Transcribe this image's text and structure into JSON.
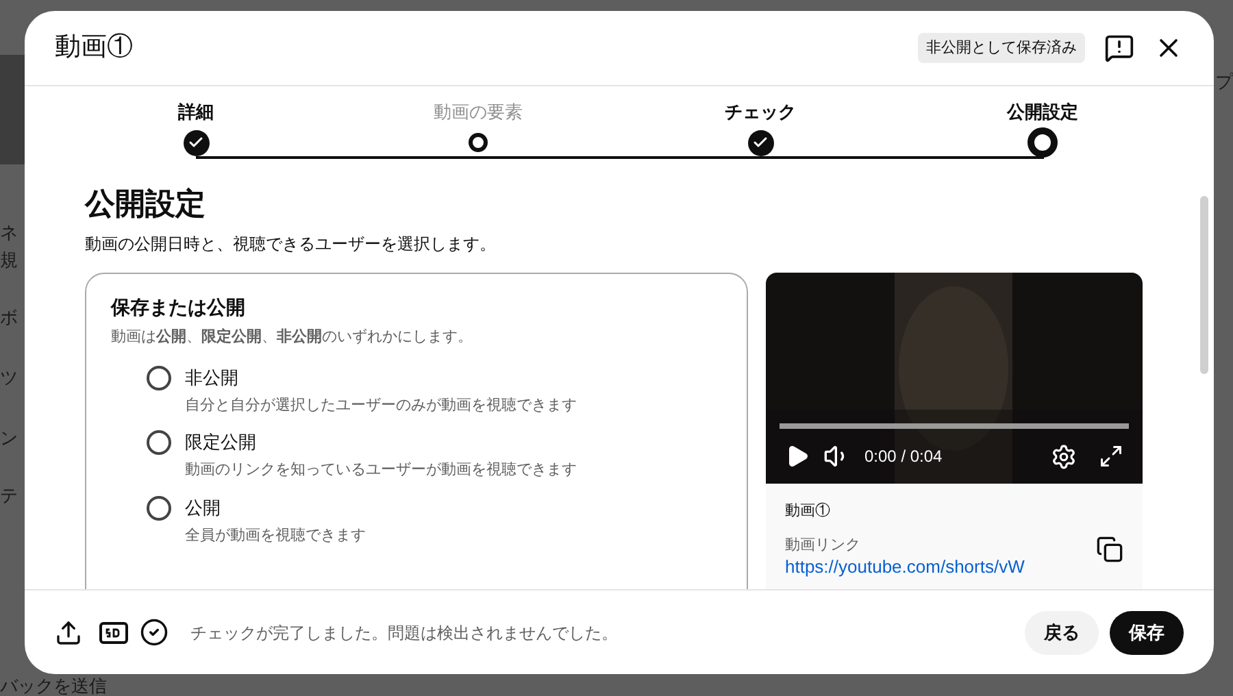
{
  "backdrop": {
    "fragments": [
      "ネ",
      "規",
      "ボ",
      "ツ",
      "ン",
      "テ",
      "バックを送信",
      "プ"
    ]
  },
  "dialog": {
    "title": "動画①",
    "save_state": "非公開として保存済み"
  },
  "steps": [
    {
      "label": "詳細",
      "kind": "done"
    },
    {
      "label": "動画の要素",
      "kind": "open"
    },
    {
      "label": "チェック",
      "kind": "done"
    },
    {
      "label": "公開設定",
      "kind": "current"
    }
  ],
  "section": {
    "heading": "公開設定",
    "description": "動画の公開日時と、視聴できるユーザーを選択します。"
  },
  "visibility": {
    "title": "保存または公開",
    "description": "動画は**公開**、**限定公開**、**非公開**のいずれかにします。",
    "options": [
      {
        "label": "非公開",
        "hint": "自分と自分が選択したユーザーのみが動画を視聴できます",
        "selected": false
      },
      {
        "label": "限定公開",
        "hint": "動画のリンクを知っているユーザーが動画を視聴できます",
        "selected": false
      },
      {
        "label": "公開",
        "hint": "全員が動画を視聴できます",
        "selected": false
      }
    ]
  },
  "preview": {
    "time": "0:00 / 0:04",
    "title": "動画①",
    "link_label": "動画リンク",
    "link": "https://youtube.com/shorts/vW"
  },
  "footer": {
    "status": "チェックが完了しました。問題は検出されませんでした。",
    "buttons": [
      {
        "label": "戻る",
        "kind": "secondary"
      },
      {
        "label": "保存",
        "kind": "primary"
      }
    ]
  }
}
